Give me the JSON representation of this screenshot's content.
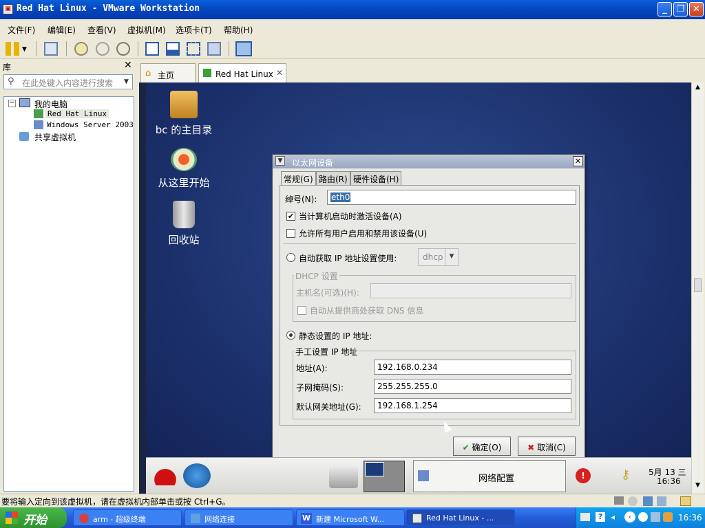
{
  "window": {
    "title": "Red Hat Linux - VMware Workstation"
  },
  "menu": [
    "文件(F)",
    "编辑(E)",
    "查看(V)",
    "虚拟机(M)",
    "选项卡(T)",
    "帮助(H)"
  ],
  "library": {
    "header": "库",
    "search_placeholder": "在此处键入内容进行搜索",
    "tree": {
      "root": "我的电脑",
      "vms": [
        "Red Hat Linux",
        "Windows Server 2003"
      ],
      "shared": "共享虚拟机"
    }
  },
  "tabs": [
    {
      "label": "主页"
    },
    {
      "label": "Red Hat Linux"
    }
  ],
  "desktop_icons": [
    "bc 的主目录",
    "从这里开始",
    "回收站"
  ],
  "dialog": {
    "title": "以太网设备",
    "tabs": [
      "常规(G)",
      "路由(R)",
      "硬件设备(H)"
    ],
    "nickname_label": "绰号(N):",
    "nickname_value": "eth0",
    "activate_on_boot": "当计算机启动时激活设备(A)",
    "allow_users": "允许所有用户启用和禁用该设备(U)",
    "auto_ip_label": "自动获取 IP 地址设置使用:",
    "auto_ip_method": "dhcp",
    "dhcp_frame": "DHCP 设置",
    "hostname_label": "主机名(可选)(H):",
    "auto_dns": "自动从提供商处获取 DNS 信息",
    "static_label": "静态设置的 IP 地址:",
    "manual_frame": "手工设置 IP 地址",
    "address_label": "地址(A):",
    "address_value": "192.168.0.234",
    "netmask_label": "子网掩码(S):",
    "netmask_value": "255.255.255.0",
    "gateway_label": "默认网关地址(G):",
    "gateway_value": "192.168.1.254",
    "ok": "确定(O)",
    "cancel": "取消(C)"
  },
  "vm_panel": {
    "task": "网络配置",
    "date": "5月 13 三",
    "time": "16:36"
  },
  "status_text": "要将输入定向到该虚拟机，请在虚拟机内部单击或按 Ctrl+G。",
  "taskbar": {
    "start": "开始",
    "tasks": [
      "arm - 超级终端",
      "网络连接",
      "新建 Microsoft W...",
      "Red Hat Linux - ..."
    ],
    "clock": "16:36"
  },
  "colors": {
    "xp_blue": "#0445c0",
    "desktop": "#1a2e68",
    "start_green": "#2f922f"
  }
}
